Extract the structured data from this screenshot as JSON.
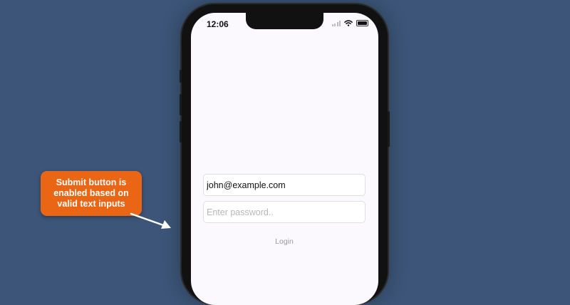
{
  "status_bar": {
    "time": "12:06"
  },
  "login_form": {
    "email_value": "john@example.com",
    "password_placeholder": "Enter password..",
    "login_label": "Login"
  },
  "annotation": {
    "text": "Submit button is enabled based on valid text inputs"
  },
  "colors": {
    "background": "#3c5578",
    "callout": "#ea6614",
    "screen": "#fbf9fd"
  }
}
